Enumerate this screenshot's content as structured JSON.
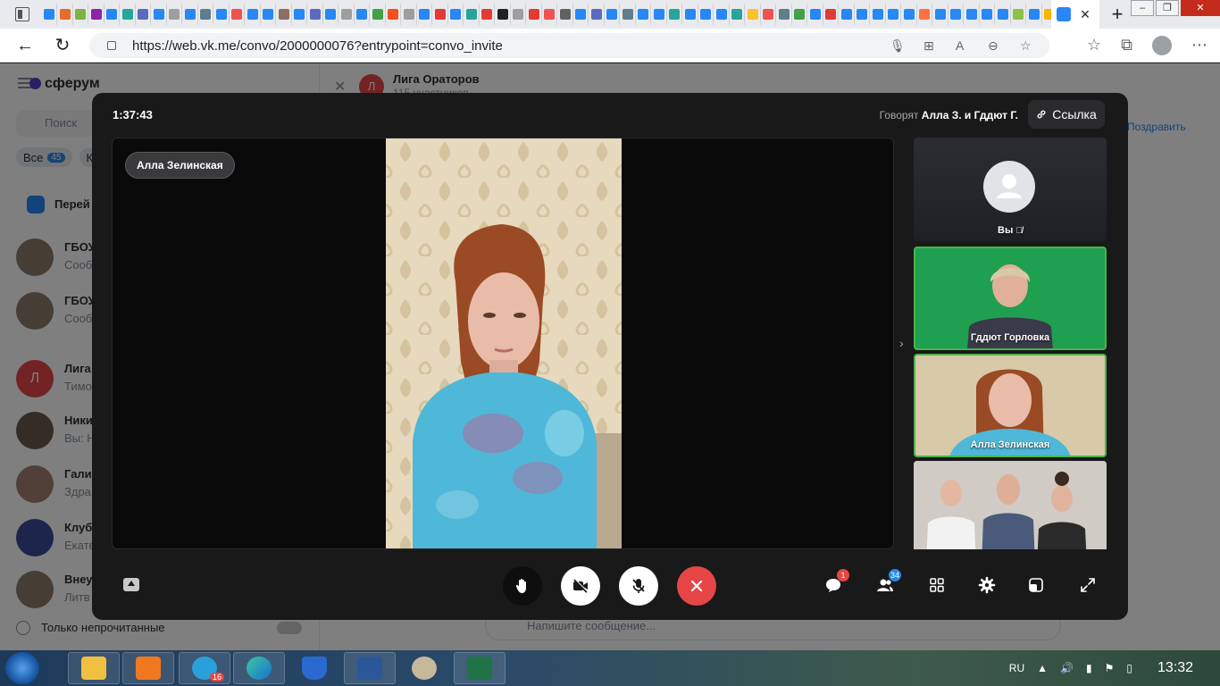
{
  "browser": {
    "active_tab": {
      "close_icon": "close-icon"
    },
    "url": "https://web.vk.me/convo/2000000076?entrypoint=convo_invite",
    "new_tab_label": "+",
    "mini_tab_colors": [
      "#2787f5",
      "#e96a2a",
      "#7cb342",
      "#8e24aa",
      "#2787f5",
      "#26a69a",
      "#5c6bc0",
      "#2787f5",
      "#9e9e9e",
      "#2787f5",
      "#607d8b",
      "#2787f5",
      "#ef5350",
      "#2787f5",
      "#2787f5",
      "#8d6e63",
      "#2787f5",
      "#5c6bc0",
      "#2787f5",
      "#9e9e9e",
      "#2787f5",
      "#43a047",
      "#f4511e",
      "#9e9e9e",
      "#2787f5",
      "#e53935",
      "#2787f5",
      "#26a69a",
      "#e53935",
      "#212121",
      "#9e9e9e",
      "#e53935",
      "#ef5350",
      "#616161",
      "#2787f5",
      "#5c6bc0",
      "#2787f5",
      "#607d8b",
      "#2787f5",
      "#2787f5",
      "#26a69a",
      "#2787f5",
      "#2787f5",
      "#2787f5",
      "#26a69a",
      "#fbc02d",
      "#ef5350",
      "#607d8b",
      "#43a047",
      "#2787f5",
      "#e53935",
      "#2787f5",
      "#2787f5",
      "#2787f5",
      "#2787f5",
      "#2787f5",
      "#ff7043",
      "#2787f5",
      "#2787f5",
      "#2787f5",
      "#2787f5",
      "#2787f5",
      "#8bc34a",
      "#2787f5",
      "#ffb300",
      "#2787f5",
      "#2787f5",
      "#5c6bc0",
      "#2787f5"
    ]
  },
  "vk": {
    "logo": "сферум",
    "search_placeholder": "Поиск",
    "filter_all": "Все",
    "filter_all_count": "45",
    "filter_second": "Ка",
    "pinned_banner": "Перей",
    "chats": [
      {
        "name": "ГБОУ",
        "msg": "Сообщ",
        "color": "#8d7b6b"
      },
      {
        "name": "ГБОУ",
        "msg": "Сообщ",
        "color": "#8d7b6b"
      },
      {
        "name": "Лига",
        "msg": "Тимо",
        "color": "#e64646",
        "letter": "Л"
      },
      {
        "name": "Ники",
        "msg": "Вы: Н",
        "color": "#6b5a4b"
      },
      {
        "name": "Гали",
        "msg": "Здра",
        "color": "#a08070"
      },
      {
        "name": "Клуб",
        "msg": "Екате",
        "color": "#3a4a9a"
      },
      {
        "name": "Внеу",
        "msg": "Литв",
        "color": "#8d7b6b"
      }
    ],
    "unread_only": "Только непрочитанные",
    "conversation": {
      "title": "Лига Ораторов",
      "subtitle": "115 участников",
      "avatar_letter": "Л"
    },
    "congrats": "Поздравить",
    "message_placeholder": "Напишите сообщение..."
  },
  "call": {
    "timer": "1:37:43",
    "speaking_prefix": "Говорят",
    "speaking_names": "Алла З. и Гддют Г.",
    "link_button": "Ссылка",
    "main_speaker": "Алла Зелинская",
    "tiles": [
      {
        "label": "Вы"
      },
      {
        "label": "Гддют Горловка"
      },
      {
        "label": "Алла Зелинская"
      },
      {
        "label": ""
      }
    ],
    "chat_badge": "1",
    "participants_badge": "34",
    "colors": {
      "end_call": "#e64646",
      "active_tile": "#4bb34b",
      "badge": "#2688eb",
      "chat_badge": "#e64646"
    }
  },
  "taskbar": {
    "apps": [
      "file-explorer",
      "media-player",
      "telegram",
      "edge",
      "shield-app",
      "word",
      "paint",
      "excel"
    ],
    "telegram_badge": "16",
    "language": "RU",
    "clock": "13:32"
  }
}
